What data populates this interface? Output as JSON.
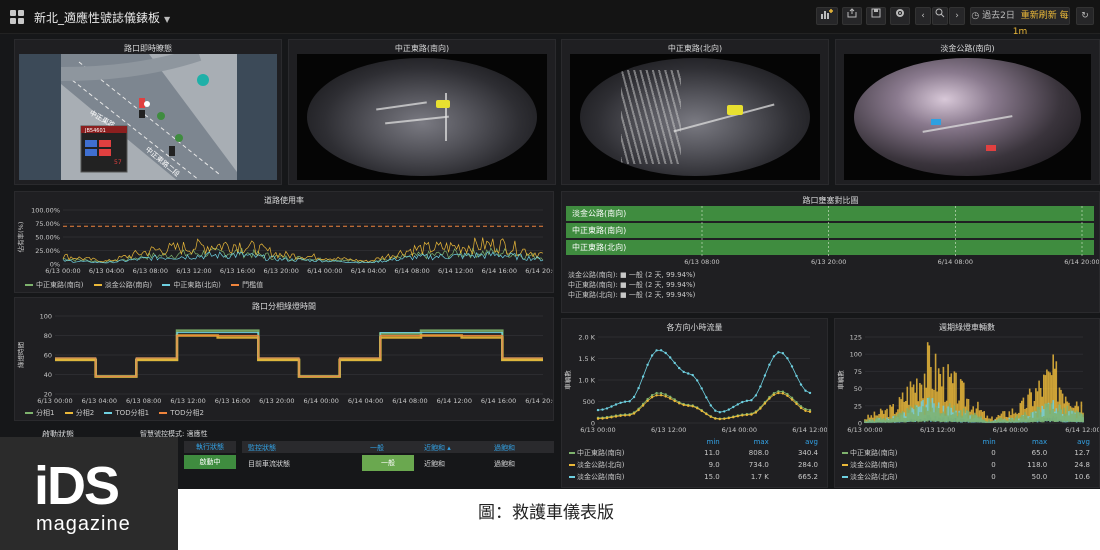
{
  "header": {
    "title": "新北_適應性號誌儀錶板",
    "time_range": "過去2日",
    "refresh": "重新刷新 每 1m"
  },
  "panels": {
    "map": {
      "title": "路口即時瞭態",
      "road1": "中正東路一段",
      "road2": "中正東路二段",
      "box_id": "JB54601",
      "box_value": "57"
    },
    "cam1": {
      "title": "中正東路(南向)"
    },
    "cam2": {
      "title": "中正東路(北向)"
    },
    "cam3": {
      "title": "淡金公路(南向)"
    },
    "occupancy": {
      "title": "道路使用率",
      "ylabel": "佔有率(%)",
      "yticks": [
        "100.00%",
        "75.00%",
        "50.00%",
        "25.00%",
        "0%"
      ],
      "xticks": [
        "6/13 00:00",
        "6/13 04:00",
        "6/13 08:00",
        "6/13 12:00",
        "6/13 16:00",
        "6/13 20:00",
        "6/14 00:00",
        "6/14 04:00",
        "6/14 08:00",
        "6/14 12:00",
        "6/14 16:00",
        "6/14 20:00"
      ],
      "legend": [
        "中正東路(南向)",
        "淡金公路(南向)",
        "中正東路(北向)",
        "門檻值"
      ]
    },
    "status_timeline": {
      "title": "路口壅塞對比圖",
      "rows": [
        "淡金公路(南向)",
        "中正東路(南向)",
        "中正東路(北向)"
      ],
      "xticks": [
        "6/13 08:00",
        "6/13 20:00",
        "6/14 08:00",
        "6/14 20:00"
      ],
      "legend": [
        "淡金公路(南向): ■ 一般 (2 天, 99.94%)",
        "中正東路(南向): ■ 一般 (2 天, 99.94%)",
        "中正東路(北向): ■ 一般 (2 天, 99.94%)"
      ]
    },
    "phase": {
      "title": "路口分相綠燈時間",
      "ylabel": "綠燈時間",
      "yticks": [
        "100",
        "80",
        "60",
        "40",
        "20"
      ],
      "xticks": [
        "6/13 00:00",
        "6/13 04:00",
        "6/13 08:00",
        "6/13 12:00",
        "6/13 16:00",
        "6/13 20:00",
        "6/14 00:00",
        "6/14 04:00",
        "6/14 08:00",
        "6/14 12:00",
        "6/14 16:00",
        "6/14 20:00"
      ],
      "legend": [
        "分相1",
        "分相2",
        "TOD分相1",
        "TOD分相2"
      ]
    },
    "flow": {
      "title": "各方向小時流量",
      "yticks": [
        "2.0 K",
        "1.5 K",
        "1.0 K",
        "500",
        "0"
      ],
      "xticks": [
        "6/13 00:00",
        "6/13 12:00",
        "6/14 00:00",
        "6/14 12:00"
      ],
      "ylabel": "車輛數",
      "headers": [
        "",
        "min",
        "max",
        "avg"
      ],
      "rows": [
        [
          "中正東路(南向)",
          "11.0",
          "808.0",
          "340.4"
        ],
        [
          "淡金公路(北向)",
          "9.0",
          "734.0",
          "284.0"
        ],
        [
          "淡金公路(南向)",
          "15.0",
          "1.7 K",
          "665.2"
        ]
      ]
    },
    "minute_flow": {
      "title": "週期綠燈車輛數",
      "yticks": [
        "125",
        "100",
        "75",
        "50",
        "25",
        "0"
      ],
      "xticks": [
        "6/13 00:00",
        "6/13 12:00",
        "6/14 00:00",
        "6/14 12:00"
      ],
      "ylabel": "車輛數",
      "headers": [
        "",
        "min",
        "max",
        "avg"
      ],
      "rows": [
        [
          "中正東路(南向)",
          "0",
          "65.0",
          "12.7"
        ],
        [
          "淡金公路(南向)",
          "0",
          "118.0",
          "24.8"
        ],
        [
          "淡金公路(北向)",
          "0",
          "50.0",
          "10.6"
        ]
      ]
    },
    "bottom": {
      "status_label": "啟動狀態",
      "mode_label": "智慧號控模式: 適應性",
      "exec_header": "執行狀態",
      "exec_value": "啟動中",
      "table_headers": [
        "監控狀態",
        "一般",
        "近飽和 ▴",
        "過飽和"
      ],
      "row_label": "目前車流狀態",
      "row_values": [
        "一般",
        "近飽和",
        "過飽和"
      ]
    }
  },
  "logo": {
    "brand": "iDS",
    "sub": "magazine"
  },
  "caption": "圖：救護車儀表版",
  "colors": {
    "green": "#7eb26d",
    "yellow": "#eab839",
    "blue": "#6ed0e0",
    "orange": "#ef843c",
    "status_green": "#3f8c3f"
  },
  "chart_data": [
    {
      "type": "line",
      "title": "道路使用率",
      "ylabel": "佔有率(%)",
      "ylim": [
        0,
        100
      ],
      "x": [
        "6/13 00:00",
        "6/13 04:00",
        "6/13 08:00",
        "6/13 12:00",
        "6/13 16:00",
        "6/13 20:00",
        "6/14 00:00",
        "6/14 04:00",
        "6/14 08:00",
        "6/14 12:00",
        "6/14 16:00",
        "6/14 20:00"
      ],
      "series": [
        {
          "name": "中正東路(南向)",
          "values": [
            8,
            3,
            12,
            16,
            18,
            10,
            7,
            3,
            12,
            16,
            18,
            10
          ]
        },
        {
          "name": "淡金公路(南向)",
          "values": [
            12,
            4,
            20,
            26,
            30,
            14,
            10,
            4,
            22,
            26,
            30,
            14
          ]
        },
        {
          "name": "中正東路(北向)",
          "values": [
            5,
            2,
            9,
            12,
            14,
            7,
            5,
            2,
            10,
            12,
            14,
            7
          ]
        },
        {
          "name": "門檻值",
          "values": [
            70,
            70,
            70,
            70,
            70,
            70,
            70,
            70,
            70,
            70,
            70,
            70
          ]
        }
      ]
    },
    {
      "type": "line",
      "title": "路口分相綠燈時間",
      "ylabel": "綠燈時間",
      "ylim": [
        20,
        100
      ],
      "x": [
        "6/13 00:00",
        "6/13 04:00",
        "6/13 08:00",
        "6/13 12:00",
        "6/13 16:00",
        "6/13 20:00",
        "6/14 00:00",
        "6/14 04:00",
        "6/14 08:00",
        "6/14 12:00",
        "6/14 16:00",
        "6/14 20:00"
      ],
      "series": [
        {
          "name": "分相1",
          "values": [
            55,
            38,
            55,
            85,
            85,
            55,
            38,
            55,
            82,
            85,
            85,
            55
          ]
        },
        {
          "name": "分相2",
          "values": [
            55,
            38,
            55,
            80,
            78,
            55,
            38,
            55,
            78,
            80,
            78,
            55
          ]
        },
        {
          "name": "TOD分相1",
          "values": [
            57,
            38,
            57,
            83,
            83,
            57,
            38,
            57,
            83,
            83,
            83,
            57
          ]
        },
        {
          "name": "TOD分相2",
          "values": [
            57,
            38,
            57,
            80,
            80,
            57,
            38,
            57,
            80,
            80,
            80,
            57
          ]
        }
      ]
    },
    {
      "type": "line",
      "title": "各方向小時流量",
      "ylim": [
        0,
        2000
      ],
      "x": [
        "6/13 00:00",
        "6/13 06:00",
        "6/13 12:00",
        "6/13 18:00",
        "6/14 00:00",
        "6/14 06:00",
        "6/14 12:00",
        "6/14 18:00"
      ],
      "series": [
        {
          "name": "中正東路(南向)",
          "values": [
            120,
            200,
            700,
            420,
            100,
            210,
            740,
            300
          ]
        },
        {
          "name": "淡金公路(北向)",
          "values": [
            100,
            180,
            650,
            400,
            90,
            190,
            700,
            260
          ]
        },
        {
          "name": "淡金公路(南向)",
          "values": [
            300,
            500,
            1700,
            1150,
            250,
            520,
            1650,
            700
          ]
        }
      ]
    },
    {
      "type": "scatter",
      "title": "週期綠燈車輛數",
      "ylim": [
        0,
        125
      ],
      "x": [
        "6/13 00:00",
        "6/13 06:00",
        "6/13 12:00",
        "6/13 18:00",
        "6/14 00:00",
        "6/14 06:00",
        "6/14 12:00",
        "6/14 18:00"
      ],
      "series": [
        {
          "name": "中正東路(南向)",
          "values": [
            5,
            10,
            30,
            20,
            4,
            10,
            28,
            12
          ]
        },
        {
          "name": "淡金公路(南向)",
          "values": [
            8,
            25,
            95,
            55,
            6,
            25,
            80,
            30
          ]
        },
        {
          "name": "淡金公路(北向)",
          "values": [
            4,
            8,
            30,
            18,
            3,
            8,
            27,
            12
          ]
        }
      ]
    }
  ]
}
